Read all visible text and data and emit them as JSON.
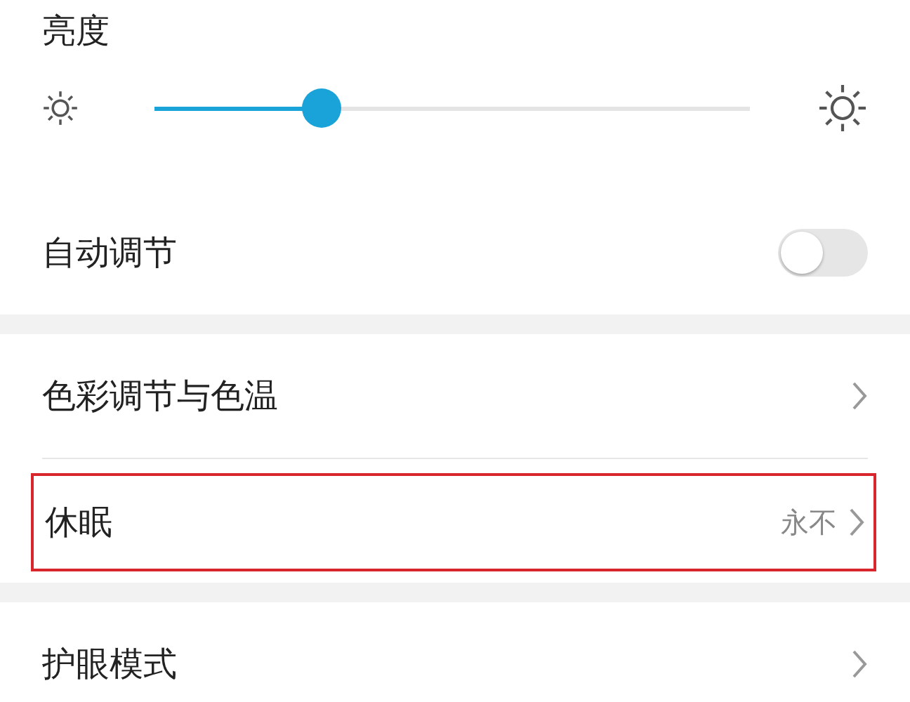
{
  "brightness": {
    "title": "亮度",
    "level": 0.28
  },
  "sections": [
    {
      "rows": [
        {
          "kind": "toggle",
          "label": "自动调节",
          "on": false
        }
      ]
    },
    {
      "rows": [
        {
          "kind": "link",
          "label": "色彩调节与色温",
          "highlighted": false
        },
        {
          "kind": "link",
          "label": "休眠",
          "value": "永不",
          "highlighted": true
        }
      ]
    },
    {
      "rows": [
        {
          "kind": "link",
          "label": "护眼模式",
          "highlighted": false
        }
      ]
    }
  ]
}
